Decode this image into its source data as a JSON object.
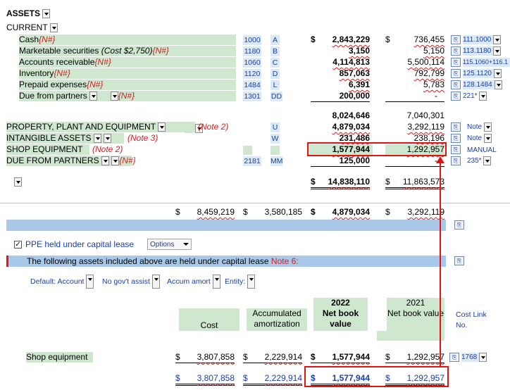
{
  "header": {
    "title": "ASSETS",
    "current": "CURRENT"
  },
  "rows": [
    {
      "label": "Cash",
      "extra": "",
      "tag": "{N#}",
      "code": "1000",
      "letter": "A",
      "dollar": "$",
      "v2022": "2,843,229",
      "dollar2": "$",
      "v2021": "736,455",
      "link": "111.1000"
    },
    {
      "label": "Marketable securities",
      "extra": "(Cost $2,750)",
      "tag": "{N#}",
      "code": "1180",
      "letter": "B",
      "v2022": "3,150",
      "v2021": "5,150",
      "link": "113.1180"
    },
    {
      "label": "Accounts receivable",
      "extra": "",
      "tag": "{N#}",
      "code": "1060",
      "letter": "C",
      "v2022": "4,114,813",
      "v2021": "5,500,114",
      "link": "115.1060+116.1"
    },
    {
      "label": "Inventory",
      "extra": "",
      "tag": "{N#}",
      "code": "1120",
      "letter": "D",
      "v2022": "857,063",
      "v2021": "792,799",
      "link": "125.1120"
    },
    {
      "label": "Prepaid expenses",
      "extra": "",
      "tag": "{N#}",
      "code": "1484",
      "letter": "L",
      "v2022": "6,391",
      "v2021": "5,783",
      "link": "128.1484"
    },
    {
      "label": "Due from partners",
      "extra": "",
      "tag": "{N#}",
      "code": "1301",
      "letter": "DD",
      "v2022": "200,000",
      "v2021": "-",
      "link": "221*"
    }
  ],
  "current_total": {
    "v2022": "8,024,646",
    "v2021": "7,040,301"
  },
  "noncurrent": [
    {
      "label": "PROPERTY, PLANT AND EQUIPMENT",
      "note": "(Note 2)",
      "code": "",
      "letter": "U",
      "v2022": "4,879,034",
      "v2021": "3,292,119",
      "link": "Note"
    },
    {
      "label": "INTANGIBLE ASSETS",
      "note": "(Note 3)",
      "code": "",
      "letter": "W",
      "v2022": "231,486",
      "v2021": "238,196",
      "link": "Note"
    },
    {
      "label": "SHOP EQUIPMENT",
      "note": "(Note 2)",
      "code": "",
      "letter": "",
      "v2022": "1,577,944",
      "v2021": "1,292,957",
      "link": "MANUAL"
    },
    {
      "label": "DUE FROM PARTNERS",
      "note": "{N#}",
      "code": "2181",
      "letter": "MM",
      "v2022": "125,000",
      "v2021": "-",
      "link": "235*"
    }
  ],
  "grand_total": {
    "dollar": "$",
    "v2022": "14,838,110",
    "v2021": "11,863,573"
  },
  "ppe_line": {
    "dollar": "$",
    "c1": "8,459,219",
    "c2": "3,580,185",
    "c3": "4,879,034",
    "c4": "3,292,119"
  },
  "capital_lease": {
    "checkbox_label": "PPE held under capital lease",
    "options_label": "Options",
    "info_text": "The following assets included above are held under capital lease",
    "info_note": "Note 6:",
    "filters": [
      "Default: Account",
      "No gov't assist",
      "Accum amort",
      "Entity:"
    ]
  },
  "lease_table": {
    "col_cost": "Cost",
    "col_amort": "Accumulated amortization",
    "col_2022_year": "2022",
    "col_2022_sub": "Net book value",
    "col_2021_year": "2021",
    "col_2021_sub": "Net book value",
    "col_link": "Cost Link No.",
    "row_label": "Shop equipment",
    "row": {
      "cost": "3,807,858",
      "amort": "2,229,914",
      "v2022": "1,577,944",
      "v2021": "1,292,957",
      "link": "1768"
    },
    "total": {
      "cost": "3,807,858",
      "amort": "2,229,914",
      "v2022": "1,577,944",
      "v2021": "1,292,957"
    }
  },
  "colors": {
    "accent": "#1a3fa8",
    "green": "#cfe6cf",
    "highlight": "#e11414",
    "band": "#a9c8e8"
  }
}
